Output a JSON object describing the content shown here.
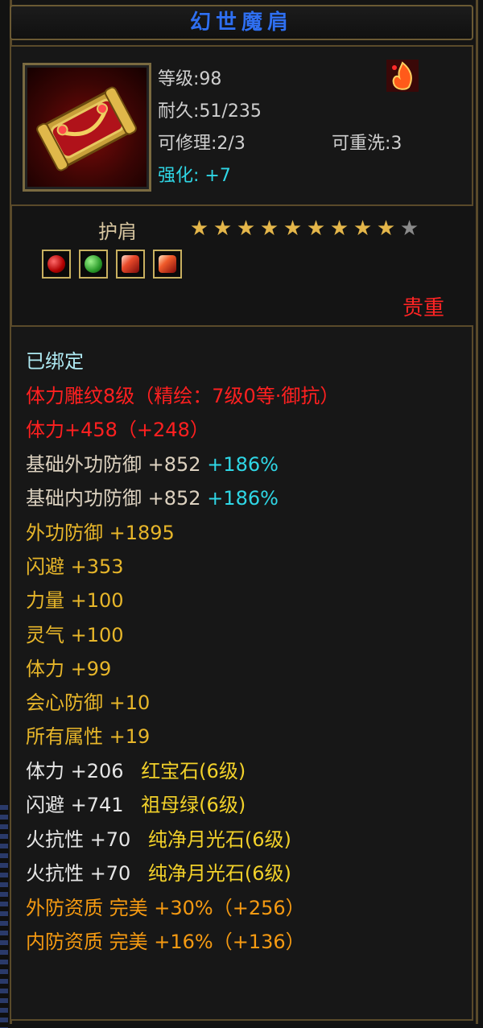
{
  "title": "幻世魔肩",
  "header": {
    "level": "等级:98",
    "durability": "耐久:51/235",
    "repairable": "可修理:2/3",
    "rewashable": "可重洗:3",
    "enhance": "强化: +7"
  },
  "slot": {
    "label": "护肩",
    "stars_filled": 9,
    "stars_total": 10,
    "gems": [
      "red-gem-icon",
      "green-gem-icon",
      "fire-feather-icon",
      "fire-feather-icon"
    ],
    "rarity": "贵重"
  },
  "stats": {
    "bound": "已绑定",
    "engrave": "体力雕纹8级（精绘：7级0等·御抗）",
    "vit_base": "体力+458（+248）",
    "pdef_name": "基础外功防御 +852",
    "pdef_pct": "+186%",
    "mdef_name": "基础内功防御 +852",
    "mdef_pct": "+186%",
    "l1": "外功防御 +1895",
    "l2": "闪避 +353",
    "l3": "力量 +100",
    "l4": "灵气 +100",
    "l5": "体力 +99",
    "l6": "会心防御 +10",
    "l7": "所有属性 +19",
    "g1a": "体力 +206",
    "g1b": "红宝石(6级)",
    "g2a": "闪避 +741",
    "g2b": "祖母绿(6级)",
    "g3a": "火抗性 +70",
    "g3b": "纯净月光石(6级)",
    "g4a": "火抗性 +70",
    "g4b": "纯净月光石(6级)",
    "q1": "外防资质  完美 +30%（+256）",
    "q2": "内防资质  完美 +16%（+136）"
  },
  "colors": {
    "title": "#2f6ff0",
    "enhance": "#2fd7e6",
    "rarity": "#ff2424",
    "engrave": "#ff2020",
    "attr": "#e7b62a",
    "gem": "#f2d12a",
    "quality": "#f59a12"
  }
}
